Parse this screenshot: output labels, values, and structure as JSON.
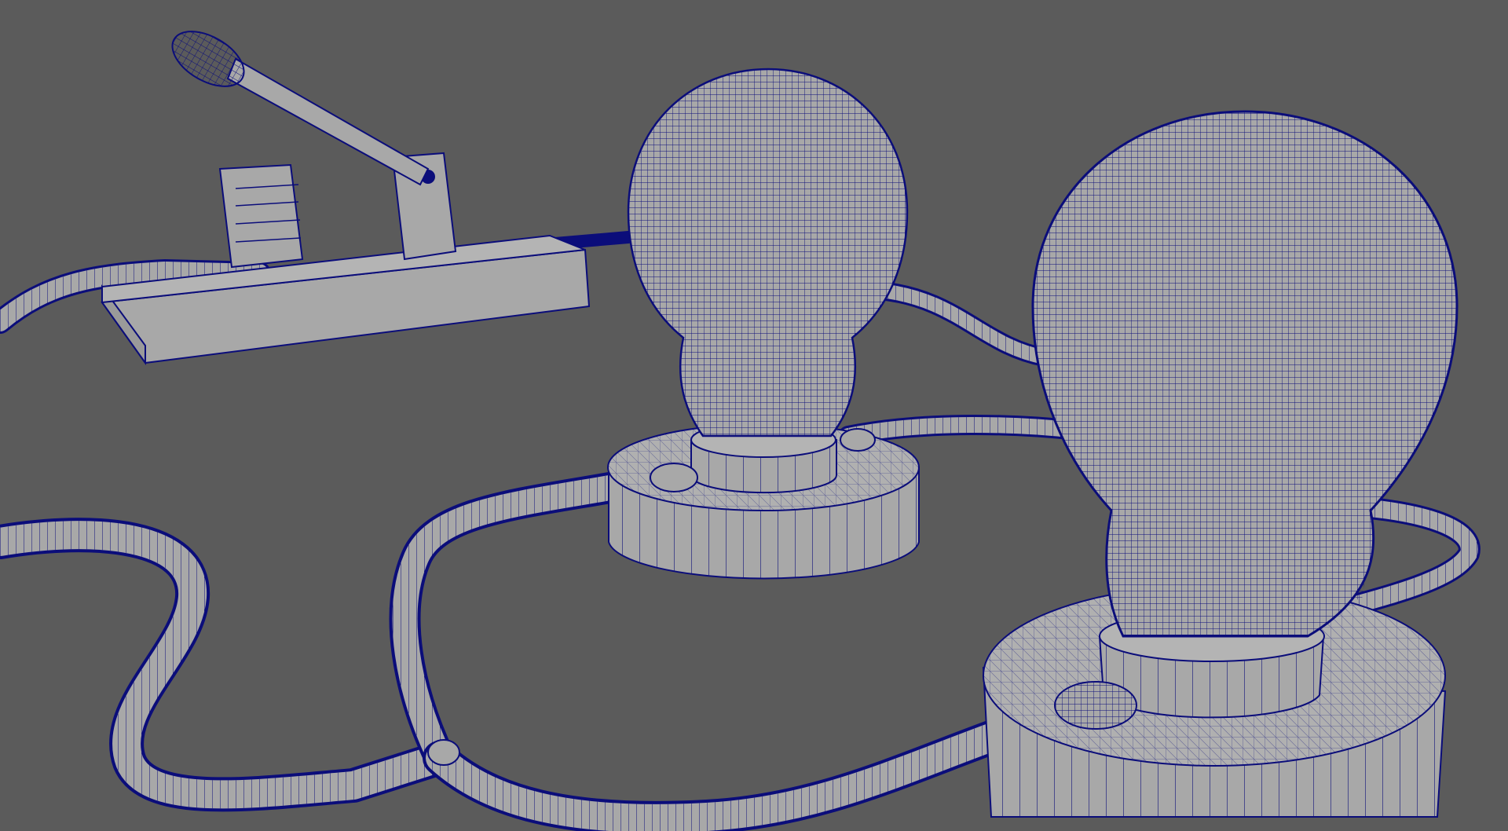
{
  "viewport": {
    "background_color": "#5b5b5b",
    "shading_mode": "wireframe-on-shaded",
    "wire_color": "#0b0d7a",
    "surface_color": "#a8a8a8",
    "objects": [
      {
        "name": "knife-switch"
      },
      {
        "name": "light-bulb-back"
      },
      {
        "name": "light-bulb-front"
      },
      {
        "name": "bulb-socket-base-back"
      },
      {
        "name": "bulb-socket-base-front"
      },
      {
        "name": "wire-cables"
      }
    ]
  }
}
